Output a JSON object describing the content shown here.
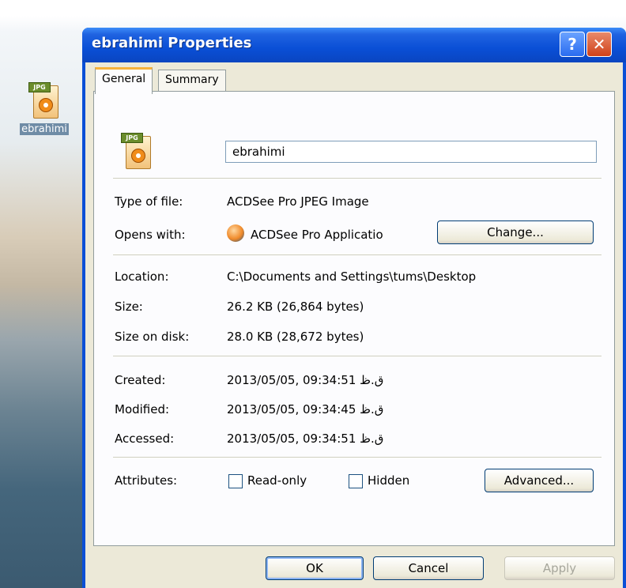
{
  "desktop": {
    "icon_label": "ebrahimi"
  },
  "window": {
    "title": "ebrahimi Properties",
    "help_glyph": "?",
    "close_glyph": "✕"
  },
  "tabs": [
    {
      "label": "General",
      "active": true
    },
    {
      "label": "Summary",
      "active": false
    }
  ],
  "icons": {
    "file_icon": "jpg-file-icon",
    "opens_with_icon": "acdsee-app-icon"
  },
  "general": {
    "name_value": "ebrahimi",
    "type_label": "Type of file:",
    "type_value": "ACDSee Pro JPEG Image",
    "opens_label": "Opens with:",
    "opens_value": "ACDSee Pro Applicatio",
    "change_button": "Change...",
    "location_label": "Location:",
    "location_value": "C:\\Documents and Settings\\tums\\Desktop",
    "size_label": "Size:",
    "size_value": "26.2 KB (26,864 bytes)",
    "size_disk_label": "Size on disk:",
    "size_disk_value": "28.0 KB (28,672 bytes)",
    "created_label": "Created:",
    "created_value": "2013/05/05, 09:34:51 ق.ظ",
    "modified_label": "Modified:",
    "modified_value": "2013/05/05, 09:34:45 ق.ظ",
    "accessed_label": "Accessed:",
    "accessed_value": "2013/05/05, 09:34:51 ق.ظ",
    "attributes_label": "Attributes:",
    "readonly_label": "Read-only",
    "hidden_label": "Hidden",
    "advanced_button": "Advanced..."
  },
  "footer": {
    "ok": "OK",
    "cancel": "Cancel",
    "apply": "Apply"
  },
  "colors": {
    "titlebar": "#0a4fd6",
    "dialog_bg": "#ece9d8",
    "tab_accent": "#f7b23b"
  }
}
